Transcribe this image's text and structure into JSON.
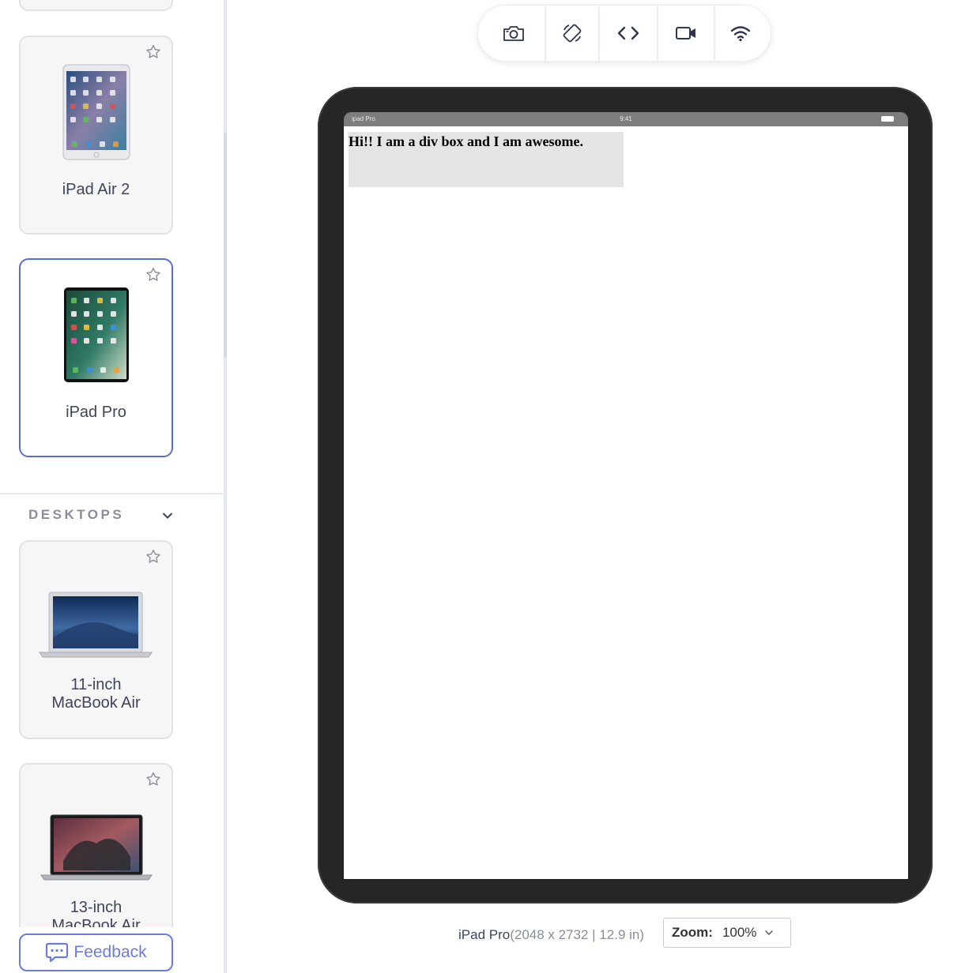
{
  "sidebar": {
    "tablets": [
      {
        "label": "iPad Air 2",
        "selected": false
      },
      {
        "label": "iPad Pro",
        "selected": true
      }
    ],
    "desktops_section_title": "DESKTOPS",
    "desktops": [
      {
        "label_line1": "11-inch",
        "label_line2": "MacBook Air"
      },
      {
        "label_line1": "13-inch",
        "label_line2": "MacBook Air"
      }
    ],
    "feedback_label": "Feedback"
  },
  "toolbar": {
    "icons": [
      "camera-icon",
      "rotate-icon",
      "code-icon",
      "video-camera-icon",
      "wifi-icon"
    ]
  },
  "device_screen": {
    "status_left": "ipad Pro",
    "status_time": "9:41",
    "demo_text": "Hi!! I am a div box and I am awesome."
  },
  "footer": {
    "device_name": "iPad Pro",
    "device_spec": "(2048 x 2732 | 12.9 in)",
    "zoom_label": "Zoom:",
    "zoom_value": "100%"
  },
  "colors": {
    "accent": "#5b6bd6",
    "feedback": "#6c7be0",
    "device_frame": "#262626"
  }
}
